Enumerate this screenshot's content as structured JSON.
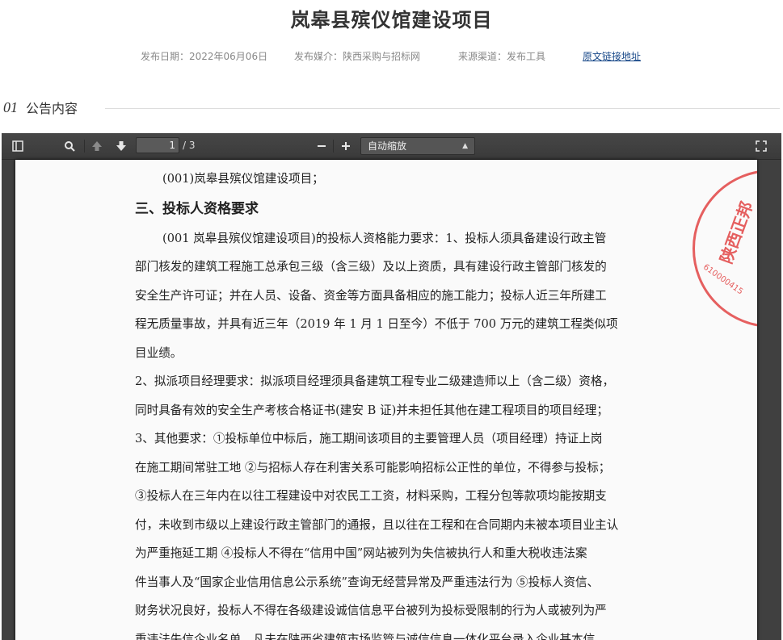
{
  "header": {
    "title": "岚皋县殡仪馆建设项目",
    "publish_date": "发布日期：2022年06月06日",
    "media": "发布媒介：陕西采购与招标网",
    "source": "来源渠道：发布工具",
    "original_link": "原文链接地址"
  },
  "section": {
    "number": "01",
    "label": "公告内容"
  },
  "viewer": {
    "page_current": "1",
    "page_total": "/ 3",
    "zoom": "自动缩放"
  },
  "document": {
    "lines": [
      "(001)岚皋县殡仪馆建设项目；",
      "(001 岚皋县殡仪馆建设项目)的投标人资格能力要求：1、投标人须具备建设行政主管",
      "部门核发的建筑工程施工总承包三级（含三级）及以上资质，具有建设行政主管部门核发的",
      "安全生产许可证；并在人员、设备、资金等方面具备相应的施工能力；投标人近三年所建工",
      "程无质量事故，并具有近三年（2019 年 1 月 1 日至今）不低于 700 万元的建筑工程类似项",
      "目业绩。",
      "2、拟派项目经理要求：拟派项目经理须具备建筑工程专业二级建造师以上（含二级）资格，",
      "同时具备有效的安全生产考核合格证书(建安 B 证)并未担任其他在建工程项目的项目经理；",
      "3、其他要求：①投标单位中标后，施工期间该项目的主要管理人员（项目经理）持证上岗",
      "在施工期间常驻工地 ②与招标人存在利害关系可能影响招标公正性的单位，不得参与投标；",
      "③投标人在三年内在以往工程建设中对农民工工资，材料采购，工程分包等款项均能按期支",
      "付，未收到市级以上建设行政主管部门的通报，且以往在工程和在合同期内未被本项目业主认",
      "为严重拖延工期 ④投标人不得在“信用中国”网站被列为失信被执行人和重大税收违法案",
      "件当事人及“国家企业信用信息公示系统”查询无经营异常及严重违法行为 ⑤投标人资信、",
      "财务状况良好，投标人不得在各级建设诚信信息平台被列为投标受限制的行为人或被列为严",
      "重违法失信企业名单，凡未在陕西省建筑市场监管与诚信信息一体化平台录入企业基本信"
    ],
    "heading": "三、投标人资格要求",
    "stamp_text": "陕西正邦",
    "stamp_number": "610000415"
  }
}
